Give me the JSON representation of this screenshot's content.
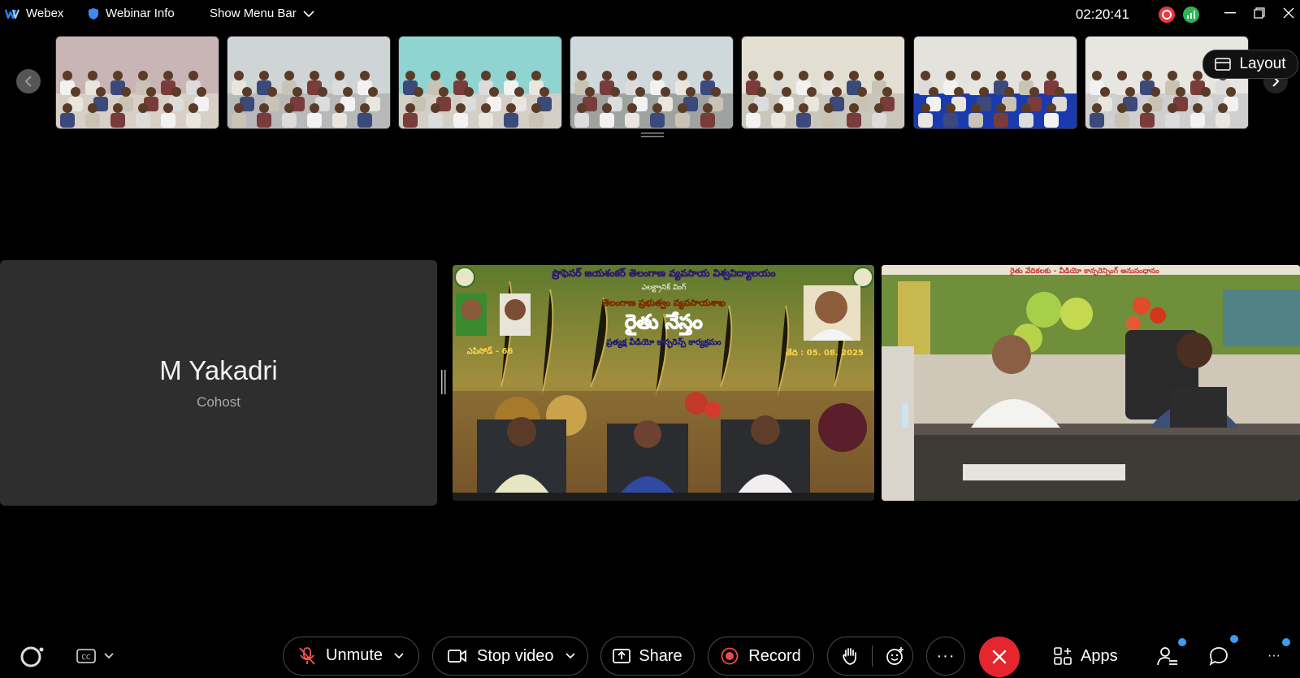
{
  "titlebar": {
    "app_name": "Webex",
    "webinar_info": "Webinar Info",
    "show_menu_bar": "Show Menu Bar",
    "clock": "02:20:41"
  },
  "filmstrip": {
    "layout_label": "Layout",
    "thumbnails": [
      {
        "label": "participant-room-1",
        "wall": "#c9b5b5",
        "floor": "#d8cfc6"
      },
      {
        "label": "participant-room-2",
        "wall": "#cfd4d6",
        "floor": "#b7b9ba"
      },
      {
        "label": "participant-room-3",
        "wall": "#8fd4d0",
        "floor": "#d3cfc7"
      },
      {
        "label": "participant-room-4",
        "wall": "#cfd8db",
        "floor": "#9fa3a0"
      },
      {
        "label": "participant-room-5",
        "wall": "#e2dfd2",
        "floor": "#c9c6bb"
      },
      {
        "label": "participant-room-6",
        "wall": "#e4e2dd",
        "floor": "#1a3bb0"
      },
      {
        "label": "participant-room-7",
        "wall": "#e7e6e1",
        "floor": "#cfcfcf"
      }
    ]
  },
  "main": {
    "participant_name": "M Yakadri",
    "participant_role": "Cohost",
    "banner": {
      "line1": "ప్రొఫెసర్ జయశంకర్ తెలంగాణ వ్యవసాయ విశ్వవిద్యాలయం",
      "line2": "ఎలక్ట్రానిక్ వింగ్",
      "line3": "తెలంగాణ ప్రభుత్వం  వ్యవసాయశాఖ",
      "title": "రైతు నేస్తం",
      "line5": "ప్రత్యక్ష వీడియో కాన్ఫరెన్స్ కార్యక్రమం",
      "episode": "ఎపిసోడ్ - 66",
      "date": "తేది : 05. 08. 2025"
    },
    "studio_banner_text": "రైతు వేదికలకు - వీడియో కాన్ఫరెన్సింగ్ అనుసంధానం"
  },
  "toolbar": {
    "unmute": "Unmute",
    "stop_video": "Stop video",
    "share": "Share",
    "record": "Record",
    "more": "···",
    "apps": "Apps",
    "overflow": "···"
  },
  "colors": {
    "end_call": "#e5262f",
    "record_red": "#e84c4c",
    "status_red": "#e8373f",
    "status_green": "#2db35a",
    "badge_blue": "#3d9cf2"
  }
}
